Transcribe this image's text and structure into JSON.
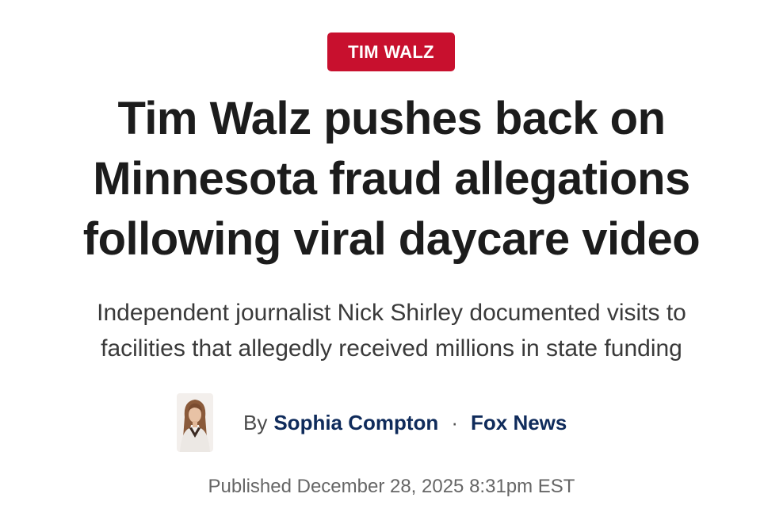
{
  "article": {
    "tag": "TIM WALZ",
    "headline": [
      "Tim Walz pushes back on",
      "Minnesota fraud allegations",
      "following viral daycare video"
    ],
    "subheadline": [
      "Independent journalist Nick Shirley documented visits to",
      "facilities that allegedly received millions in state funding"
    ],
    "byline": {
      "by_label": "By",
      "author": "Sophia Compton",
      "separator": "·",
      "source": "Fox News"
    },
    "published": "Published December 28, 2025 8:31pm EST"
  },
  "colors": {
    "tag_background": "#c8102e",
    "tag_text": "#ffffff",
    "headline_text": "#1c1c1c",
    "link_navy": "#0f2b5b",
    "meta_gray": "#666666"
  },
  "icons": {
    "avatar": "author-photo"
  }
}
